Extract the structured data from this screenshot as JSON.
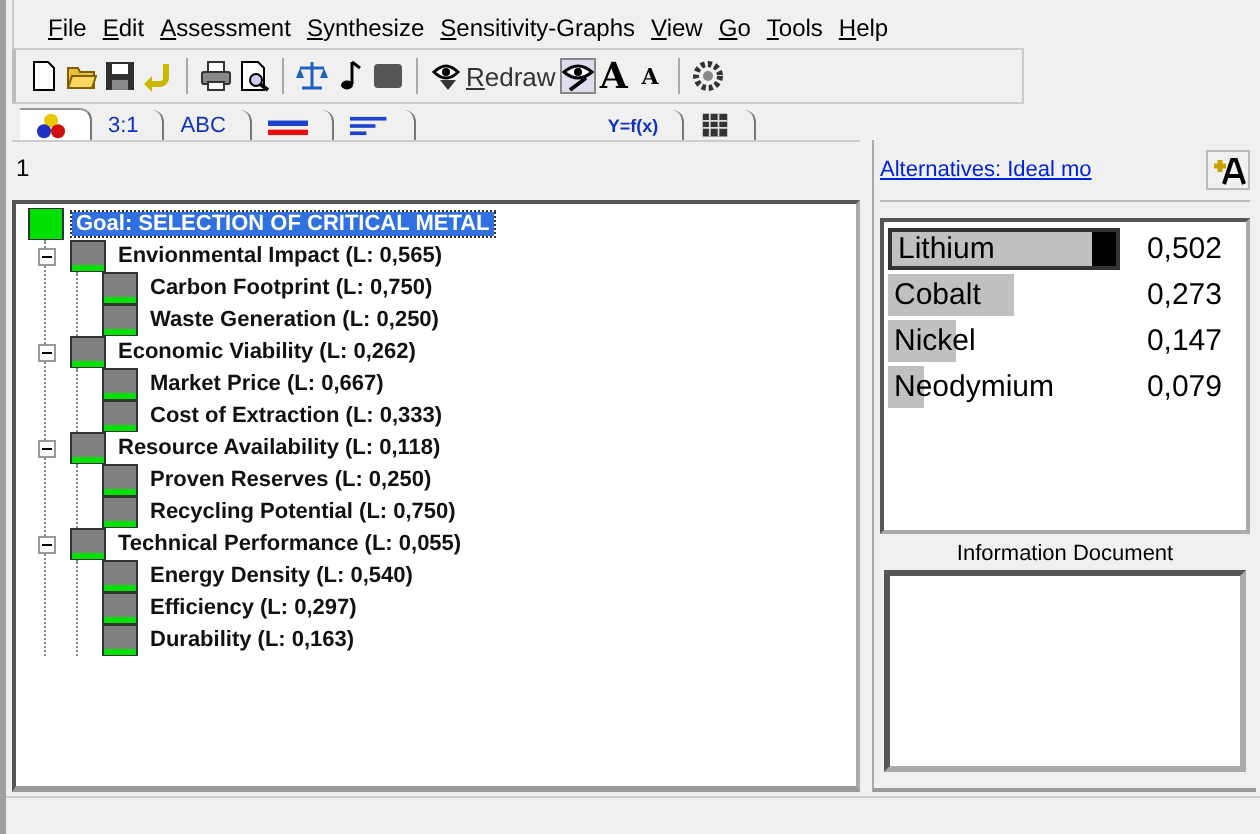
{
  "menu": [
    "File",
    "Edit",
    "Assessment",
    "Synthesize",
    "Sensitivity-Graphs",
    "View",
    "Go",
    "Tools",
    "Help"
  ],
  "toolbar": [
    {
      "kind": "new-file"
    },
    {
      "kind": "open-folder"
    },
    {
      "kind": "save"
    },
    {
      "kind": "undo"
    },
    {
      "kind": "separator"
    },
    {
      "kind": "printer"
    },
    {
      "kind": "print-preview"
    },
    {
      "kind": "separator"
    },
    {
      "kind": "scales"
    },
    {
      "kind": "note"
    },
    {
      "kind": "square"
    },
    {
      "kind": "separator"
    },
    {
      "kind": "redraw",
      "label": "Redraw"
    },
    {
      "kind": "eye-pen"
    },
    {
      "kind": "font-up",
      "label": "A"
    },
    {
      "kind": "font-down",
      "label": "A"
    },
    {
      "kind": "separator"
    },
    {
      "kind": "gear"
    }
  ],
  "tabs": [
    {
      "kind": "balls",
      "selected": true
    },
    {
      "kind": "text",
      "label": "3:1",
      "selected": false
    },
    {
      "kind": "text",
      "label": "ABC",
      "selected": false
    },
    {
      "kind": "bars",
      "selected": false
    },
    {
      "kind": "lines",
      "selected": false
    },
    {
      "kind": "gap"
    },
    {
      "kind": "text",
      "label": "Y=f(x)",
      "selected": false
    },
    {
      "kind": "grid",
      "selected": false
    }
  ],
  "tree_header": "1",
  "tree": {
    "label": "Goal: SELECTION OF CRITICAL METAL",
    "kind": "goal",
    "selected": true,
    "children": [
      {
        "label": "Envionmental Impact (L: 0,565)",
        "kind": "criterion",
        "expanded": true,
        "children": [
          {
            "label": "Carbon Footprint (L: 0,750)",
            "kind": "criterion"
          },
          {
            "label": "Waste Generation (L: 0,250)",
            "kind": "criterion"
          }
        ]
      },
      {
        "label": "Economic Viability (L: 0,262)",
        "kind": "criterion",
        "expanded": true,
        "children": [
          {
            "label": "Market Price (L: 0,667)",
            "kind": "criterion"
          },
          {
            "label": "Cost of Extraction (L: 0,333)",
            "kind": "criterion"
          }
        ]
      },
      {
        "label": "Resource Availability (L: 0,118)",
        "kind": "criterion",
        "expanded": true,
        "children": [
          {
            "label": "Proven Reserves (L: 0,250)",
            "kind": "criterion"
          },
          {
            "label": "Recycling Potential (L: 0,750)",
            "kind": "criterion"
          }
        ]
      },
      {
        "label": "Technical Performance (L: 0,055)",
        "kind": "criterion",
        "expanded": true,
        "children": [
          {
            "label": "Energy Density (L: 0,540)",
            "kind": "criterion"
          },
          {
            "label": "Efficiency (L: 0,297)",
            "kind": "criterion"
          },
          {
            "label": "Durability (L: 0,163)",
            "kind": "criterion"
          }
        ]
      }
    ]
  },
  "alternatives_link": "Alternatives: Ideal mo",
  "alternatives": [
    {
      "name": "Lithium",
      "value": "0,502",
      "level": 1,
      "selected": true
    },
    {
      "name": "Cobalt",
      "value": "0,273",
      "level": 0.544,
      "selected": false
    },
    {
      "name": "Nickel",
      "value": "0,147",
      "level": 0.293,
      "selected": false
    },
    {
      "name": "Neodymium",
      "value": "0,079",
      "level": 0.157,
      "selected": false
    }
  ],
  "info_title": "Information Document"
}
